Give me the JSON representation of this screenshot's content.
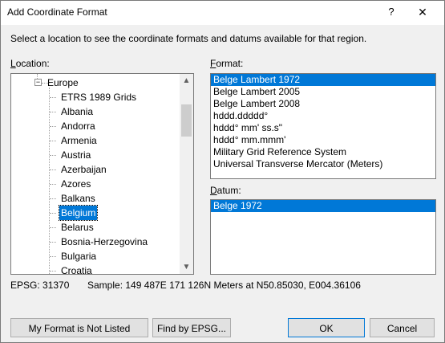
{
  "window": {
    "title": "Add Coordinate Format",
    "help_label": "?",
    "close_label": "✕"
  },
  "description": "Select a location to see the coordinate formats and datums available for that region.",
  "location": {
    "label_prefix": "L",
    "label_rest": "ocation:",
    "parent": "Europe",
    "items": [
      "ETRS 1989 Grids",
      "Albania",
      "Andorra",
      "Armenia",
      "Austria",
      "Azerbaijan",
      "Azores",
      "Balkans",
      "Belgium",
      "Belarus",
      "Bosnia-Herzegovina",
      "Bulgaria",
      "Croatia"
    ],
    "selected": "Belgium"
  },
  "format": {
    "label_prefix": "F",
    "label_rest": "ormat:",
    "items": [
      "Belge Lambert 1972",
      "Belge Lambert 2005",
      "Belge Lambert 2008",
      "hddd.ddddd°",
      "hddd° mm' ss.s\"",
      "hddd° mm.mmm'",
      "Military Grid Reference System",
      "Universal Transverse Mercator (Meters)"
    ],
    "selected": "Belge Lambert 1972"
  },
  "datum": {
    "label_prefix": "D",
    "label_rest": "atum:",
    "items": [
      "Belge 1972"
    ],
    "selected": "Belge 1972"
  },
  "status": {
    "epsg": "EPSG: 31370",
    "sample": "Sample: 149 487E  171 126N Meters at N50.85030, E004.36106"
  },
  "buttons": {
    "not_listed": "My Format is Not Listed",
    "find_epsg": "Find by EPSG...",
    "ok": "OK",
    "cancel": "Cancel"
  },
  "icons": {
    "scroll_up": "▲",
    "scroll_down": "▼",
    "collapse": "−"
  }
}
